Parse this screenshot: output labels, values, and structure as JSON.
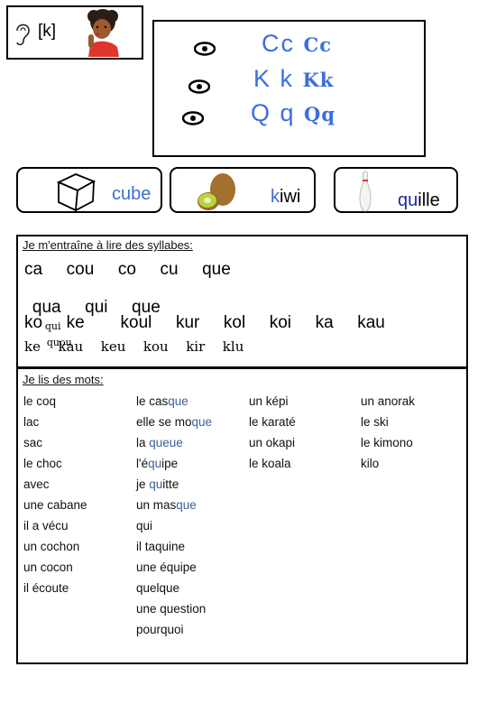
{
  "header": {
    "ear_icon": "ear-icon",
    "phoneme": "[k]",
    "illustration": "girl-thinking-illustration"
  },
  "letters": {
    "rows": [
      {
        "icon": "eye-icon",
        "script": "Cc",
        "cursive": "Cc"
      },
      {
        "icon": "eye-icon",
        "script": "K k",
        "cursive": "Kk"
      },
      {
        "icon": "eye-icon",
        "script": "Q q",
        "cursive": "Qq"
      }
    ],
    "color": "#3a6fe0"
  },
  "cards": [
    {
      "image": "cube-icon",
      "word": "cube",
      "highlight": "c",
      "rest": "ube"
    },
    {
      "image": "kiwi-icon",
      "word": "kiwi",
      "highlight": "k",
      "rest": "iwi"
    },
    {
      "image": "bowling-pin-icon",
      "word": "quille",
      "highlight": "qu",
      "rest": "ille"
    }
  ],
  "syllables": {
    "title": "Je m'entraîne à lire des syllabes:",
    "line1": "ca  cou  co  cu  que",
    "line2_big": "qua  qui  que",
    "line2_small": [
      "qui",
      "quou"
    ],
    "line3": "ko  ke   koul  kur  kol  koi  ka  kau",
    "line4": "ke  kau  keu  kou  kir  klu"
  },
  "words": {
    "title": "Je lis des mots:",
    "columns": [
      [
        "le coq",
        "lac",
        "sac",
        "le choc",
        "avec",
        "une cabane",
        "il a vécu",
        "un cochon",
        "un cocon",
        "il écoute"
      ],
      [
        "le casque",
        "elle se moque",
        "la queue",
        "l'équipe",
        "je quitte",
        "un masque",
        "qui",
        "il taquine",
        "une équipe",
        "quelque",
        "une question",
        "pourquoi"
      ],
      [
        "un képi",
        "le karaté",
        "un okapi",
        "le koala"
      ],
      [
        "un anorak",
        "le ski",
        "le kimono",
        "kilo"
      ]
    ],
    "col2_parts": [
      [
        "le cas",
        "que",
        ""
      ],
      [
        "elle se mo",
        "que",
        ""
      ],
      [
        "la ",
        "queue",
        ""
      ],
      [
        "l'é",
        "qu",
        "ipe"
      ],
      [
        "je ",
        "qu",
        "itte"
      ],
      [
        "un mas",
        "que",
        ""
      ]
    ]
  }
}
